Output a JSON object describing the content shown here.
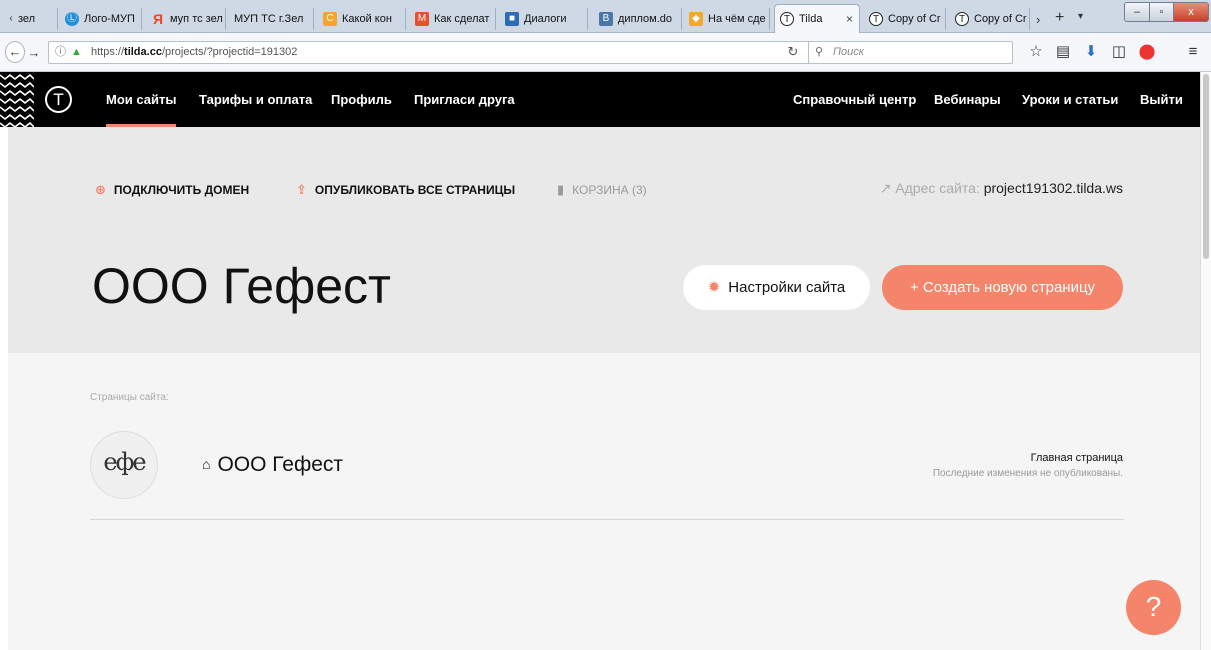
{
  "browser": {
    "tabs": [
      {
        "label": "зел",
        "icon": "‹"
      },
      {
        "label": "Лого-МУП",
        "icon": "Ⓛ"
      },
      {
        "label": "муп тс зел",
        "icon": "Я"
      },
      {
        "label": "МУП ТС г.Зел",
        "icon": ""
      },
      {
        "label": "Какой кон",
        "icon": "C"
      },
      {
        "label": "Как сделат",
        "icon": "M"
      },
      {
        "label": "Диалоги",
        "icon": "■"
      },
      {
        "label": "диплом.do",
        "icon": "B"
      },
      {
        "label": "На чём сде",
        "icon": "◆"
      },
      {
        "label": "Tilda",
        "icon": "T",
        "active": true
      },
      {
        "label": "Copy of Cr",
        "icon": "T"
      },
      {
        "label": "Copy of Cr",
        "icon": "T"
      }
    ],
    "url_prefix": "https://",
    "url_host": "tilda.cc",
    "url_path": "/projects/?projectid=191302",
    "search_placeholder": "Поиск"
  },
  "site_nav": {
    "left": [
      "Мои сайты",
      "Тарифы и оплата",
      "Профиль",
      "Пригласи друга"
    ],
    "right": [
      "Справочный центр",
      "Вебинары",
      "Уроки и статьи",
      "Выйти"
    ]
  },
  "hero": {
    "actions": {
      "connect_domain": "Подключить домен",
      "publish_all": "Опубликовать все страницы",
      "trash": "Корзина (3)"
    },
    "address_label": "Адрес сайта:",
    "address_value": "project191302.tilda.ws",
    "project_title": "ООО Гефест",
    "settings_button": "Настройки сайта",
    "create_button": "+  Создать новую страницу"
  },
  "pages": {
    "section_label": "Страницы сайта:",
    "items": [
      {
        "thumb_text": "ефе",
        "title": "ООО Гефест",
        "type": "Главная страница",
        "status": "Последние изменения не опубликованы."
      }
    ]
  },
  "colors": {
    "accent": "#f4846a",
    "navbar": "#000000",
    "hero_bg": "#e9e9e9"
  },
  "help_label": "?"
}
